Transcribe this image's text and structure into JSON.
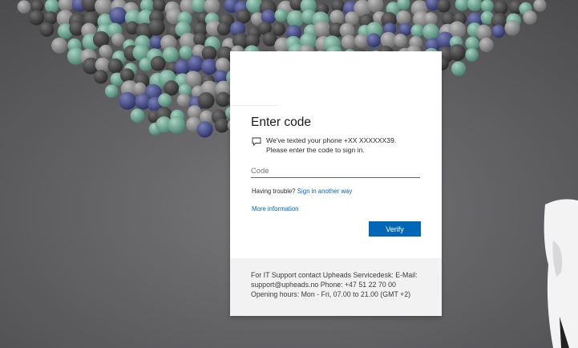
{
  "title": "Enter code",
  "message": {
    "icon": "chat-bubble-icon",
    "line1": "We've texted your phone +XX XXXXXX39.",
    "line2": "Please enter the code to sign in."
  },
  "code_input": {
    "placeholder": "Code",
    "value": ""
  },
  "trouble": {
    "prefix": "Having trouble?",
    "link": "Sign in another way"
  },
  "more_info_link": "More information",
  "verify_button": "Verify",
  "footer": {
    "line1": "For IT Support contact Upheads Servicedesk: E-Mail:",
    "line2": "support@upheads.no Phone: +47 51 22 70 00",
    "line3": "Opening hours: Mon - Fri, 07.00 to 21.00 (GMT +2)"
  },
  "colors": {
    "accent": "#0067b8",
    "background": "#5c5c5e",
    "footer_bg": "#f2f2f2"
  }
}
